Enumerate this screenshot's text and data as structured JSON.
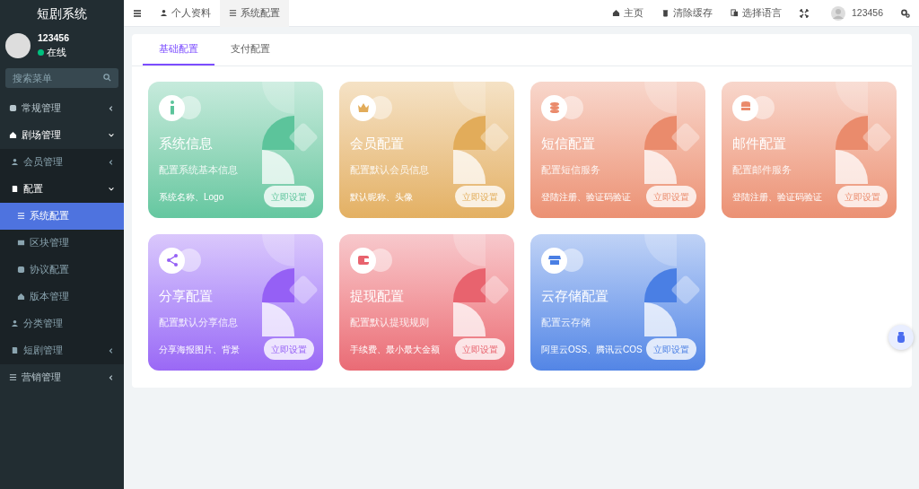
{
  "sidebar": {
    "title": "短剧系统",
    "user": {
      "name": "123456",
      "status": "在线",
      "online": true
    },
    "search": {
      "placeholder": "搜索菜单"
    },
    "items": [
      {
        "label": "常规管理",
        "expanded": false,
        "selected": false
      },
      {
        "label": "剧场管理",
        "expanded": true,
        "selected": false,
        "children": [
          {
            "label": "会员管理",
            "expanded": false,
            "selected": false
          },
          {
            "label": "配置",
            "expanded": true,
            "selected": false,
            "children": [
              {
                "label": "系统配置",
                "selected": true
              },
              {
                "label": "区块管理",
                "selected": false
              },
              {
                "label": "协议配置",
                "selected": false
              },
              {
                "label": "版本管理",
                "selected": false
              }
            ]
          },
          {
            "label": "分类管理",
            "selected": false
          },
          {
            "label": "短剧管理",
            "expanded": false,
            "selected": false
          }
        ]
      },
      {
        "label": "营销管理",
        "expanded": false,
        "selected": false
      }
    ]
  },
  "topbar": {
    "tabs": [
      {
        "label": "个人资料",
        "selected": false
      },
      {
        "label": "系统配置",
        "selected": true
      }
    ],
    "links": [
      "主页",
      "清除缓存",
      "选择语言"
    ],
    "user": "123456"
  },
  "panel": {
    "tabs": [
      {
        "label": "基础配置",
        "selected": true
      },
      {
        "label": "支付配置",
        "selected": false
      }
    ],
    "cards": [
      {
        "title": "系统信息",
        "description": "配置系统基本信息",
        "features": "系统名称、Logo",
        "button": "立即设置",
        "color": "#5cc49b"
      },
      {
        "title": "会员配置",
        "description": "配置默认会员信息",
        "features": "默认昵称、头像",
        "button": "立即设置",
        "color": "#e2ac5a"
      },
      {
        "title": "短信配置",
        "description": "配置短信服务",
        "features": "登陆注册、验证码验证",
        "button": "立即设置",
        "color": "#ea8b6c"
      },
      {
        "title": "邮件配置",
        "description": "配置邮件服务",
        "features": "登陆注册、验证码验证",
        "button": "立即设置",
        "color": "#ea8b6c"
      },
      {
        "title": "分享配置",
        "description": "配置默认分享信息",
        "features": "分享海报图片、背景",
        "button": "立即设置",
        "color": "#9560f5"
      },
      {
        "title": "提现配置",
        "description": "配置默认提现规则",
        "features": "手续费、最小最大金额",
        "button": "立即设置",
        "color": "#e8636e"
      },
      {
        "title": "云存储配置",
        "description": "配置云存储",
        "features": "阿里云OSS、腾讯云COS",
        "button": "立即设置",
        "color": "#4a7fe4"
      }
    ]
  }
}
